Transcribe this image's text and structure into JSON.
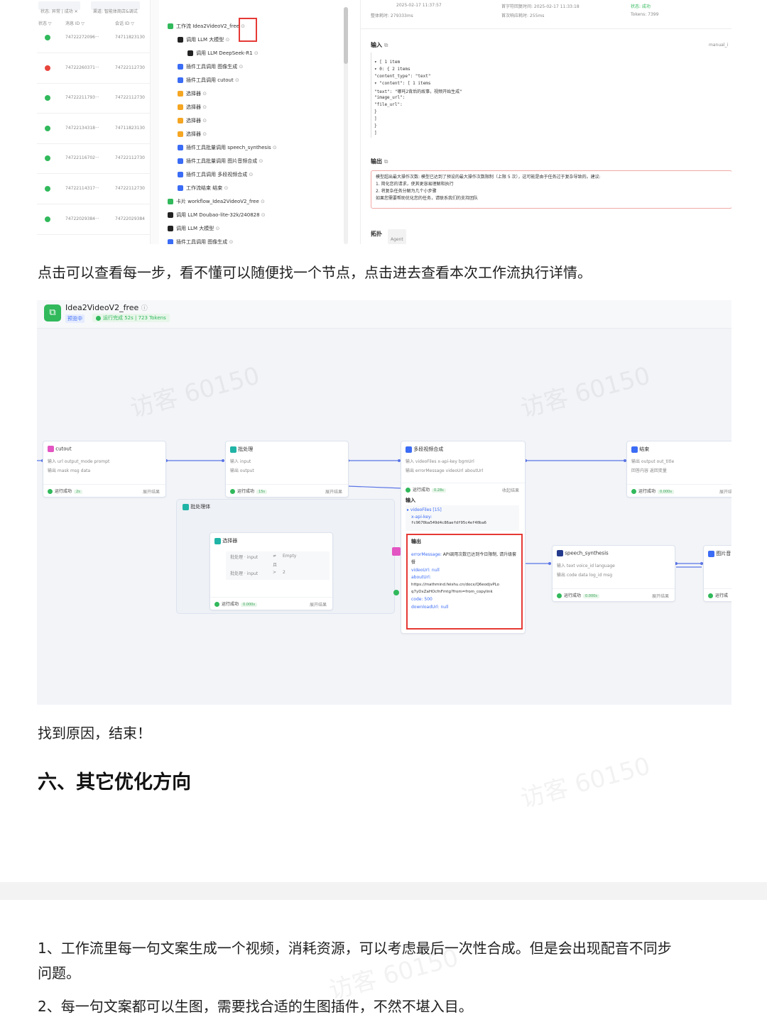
{
  "screenshot1": {
    "filters": {
      "status": "状态: 异常 | 成功 ✕",
      "channel": "渠道: 智能体商店&调试"
    },
    "columns": {
      "status": "状态",
      "msg_id": "消息 ID",
      "session_id": "会话 ID"
    },
    "rows": [
      {
        "status": "success",
        "msg_id": "74722272096···",
        "session_id": "74711823130"
      },
      {
        "status": "error",
        "msg_id": "74722260371···",
        "session_id": "74722112730"
      },
      {
        "status": "success",
        "msg_id": "74722211793···",
        "session_id": "74722112730"
      },
      {
        "status": "success",
        "msg_id": "74722134318···",
        "session_id": "74711823130"
      },
      {
        "status": "success",
        "msg_id": "74722116702···",
        "session_id": "74722112730"
      },
      {
        "status": "success",
        "msg_id": "74722114317···",
        "session_id": "74722112730"
      },
      {
        "status": "success",
        "msg_id": "74722029384···",
        "session_id": "74722029384"
      }
    ],
    "tree": [
      {
        "label": "工作流 Idea2VideoV2_free",
        "level": 0,
        "color": "#31b95b"
      },
      {
        "label": "调用 LLM 大模型",
        "level": 1,
        "color": "#222222"
      },
      {
        "label": "调用 LLM DeepSeek-R1",
        "level": 2,
        "color": "#222222"
      },
      {
        "label": "插件工具调用 图像生成",
        "level": 1,
        "color": "#3b6cf5"
      },
      {
        "label": "插件工具调用 cutout",
        "level": 1,
        "color": "#3b6cf5"
      },
      {
        "label": "选择器",
        "level": 1,
        "color": "#f5a623"
      },
      {
        "label": "选择器",
        "level": 1,
        "color": "#f5a623"
      },
      {
        "label": "选择器",
        "level": 1,
        "color": "#f5a623"
      },
      {
        "label": "选择器",
        "level": 1,
        "color": "#f5a623"
      },
      {
        "label": "插件工具批量调用 speech_synthesis",
        "level": 1,
        "color": "#3b6cf5"
      },
      {
        "label": "插件工具批量调用 图片音频合成",
        "level": 1,
        "color": "#3b6cf5"
      },
      {
        "label": "插件工具调用 多段视频合成",
        "level": 1,
        "color": "#3b6cf5"
      },
      {
        "label": "工作流结束 结束",
        "level": 1,
        "color": "#3b6cf5"
      },
      {
        "label": "卡片 workflow_Idea2VideoV2_free",
        "level": 0,
        "color": "#31b95b"
      },
      {
        "label": "调用 LLM Doubao-lite-32k/240828",
        "level": 0,
        "color": "#222222"
      },
      {
        "label": "调用 LLM 大模型",
        "level": 0,
        "color": "#222222"
      },
      {
        "label": "插件工具调用 图像生成",
        "level": 0,
        "color": "#3b6cf5"
      }
    ],
    "meta": {
      "start_time": "2025-02-17 11:37:57",
      "total_time": "整体耗时: 279333ms",
      "first_reply": "首字符回复时间: 2025-02-17 11:33:18",
      "first_char_time": "首次响应耗时: 255ms",
      "status": "状态: 成功",
      "tokens": "Tokens: 7399"
    },
    "input_label": "输入",
    "input_mode": "manual_i",
    "input_json": [
      "▾ [  1 item",
      "  ▾ 0: {  2 items",
      "      \"content_type\": \"text\"",
      "    ▾ \"content\": [  1 items",
      "        \"text\": \"哪吒2背后的故事，视频开始生成\"",
      "        \"image_url\":",
      "        \"file_url\":",
      "      }",
      "    ]",
      "  }",
      "]"
    ],
    "output_label": "输出",
    "output_lines": [
      "模型超出最大操作次数: 模型已达到了预设的最大操作次数限制（上限 5 次），这可能是由于任务过于复杂导致的。建议:",
      "1. 简化您的请求，使其更容易理解和执行",
      "2. 将复杂任务分解为几个小步骤",
      "如果您需要帮助优化您的任务，请联系我们的支持团队"
    ],
    "topology_label": "拓扑",
    "topology_tag": "Agent"
  },
  "para1": "点击可以查看每一步，看不懂可以随便找一个节点，点击进去查看本次工作流执行详情。",
  "screenshot2": {
    "title": "Idea2VideoV2_free",
    "badge": "预览中",
    "run_status": "运行完成 52s | 723 Tokens",
    "nodes": {
      "cutout": {
        "title": "cutout",
        "inputs": "url   output_mode   prompt",
        "outputs": "mask   msg   data",
        "status": "运行成功",
        "time": "2s",
        "btn": "展开结果"
      },
      "batch": {
        "title": "批处理",
        "inputs": "input",
        "outputs": "output",
        "status": "运行成功",
        "time": "15s",
        "btn": "展开结果"
      },
      "multivideo": {
        "title": "多段视频合成",
        "inputs": "videoFiles   x-api-key   bgmUrl",
        "outputs": "errorMessage   videoUrl   aboutUrl",
        "status": "运行成功",
        "time": "0.28s",
        "btn": "收起结果"
      },
      "end": {
        "title": "结束",
        "inputs": "output   out_title",
        "outputs": "返回变量",
        "status": "运行成功",
        "time": "0.000s",
        "btn": "展开结果"
      },
      "batchbody": {
        "title": "批处理体"
      },
      "selector": {
        "title": "选择器",
        "cond1_left": "批处理 · input",
        "cond1_op": "≠",
        "cond1_right": "Empty",
        "cond_and": "且",
        "cond2_left": "批处理 · input",
        "cond2_op": ">",
        "cond2_right": "2",
        "status": "运行成功",
        "time": "0.000s",
        "btn": "展开结果"
      },
      "speech": {
        "title": "speech_synthesis",
        "inputs": "text   voice_id   language",
        "outputs": "code   data   log_id   msg",
        "status": "运行成功",
        "time": "0.000s",
        "btn": "展开结果"
      },
      "image": {
        "title": "图片音",
        "status": "运行成"
      }
    },
    "result_panel": {
      "input_label": "输入",
      "videofiles": "▸ videoFiles [15]",
      "apikey_label": "x-api-key:",
      "apikey_value": "fc9670ba549d4c86aefdf95c4ef40ba6",
      "output_label": "输出",
      "error_label": "errorMessage:",
      "error_value": "API调用次数已达到今日限制, 请升级套餐",
      "videourl": "videoUrl: null",
      "abouturl_label": "aboutUrl:",
      "abouturl_value1": "https://mathmind.feishu.cn/docx/Q6eodjvPLo",
      "abouturl_value2": "q7yDxZaHOcfnFmtg?from=from_copylink",
      "code": "code: 500",
      "download": "downloadUrl: null"
    }
  },
  "para2": "找到原因，结束！",
  "heading": "六、其它优化方向",
  "item1_line1": "1、工作流里每一句文案生成一个视频，消耗资源，可以考虑最后一次性合成。但是会出现配音不同步",
  "item1_line2": "问题。",
  "item2": "2、每一句文案都可以生图，需要找合适的生图插件，不然不堪入目。",
  "watermark": "访客 60150",
  "colors": {
    "accent": "#3b6cf5",
    "success": "#31b95b",
    "error": "#e8443b",
    "highlight": "#e53935"
  }
}
